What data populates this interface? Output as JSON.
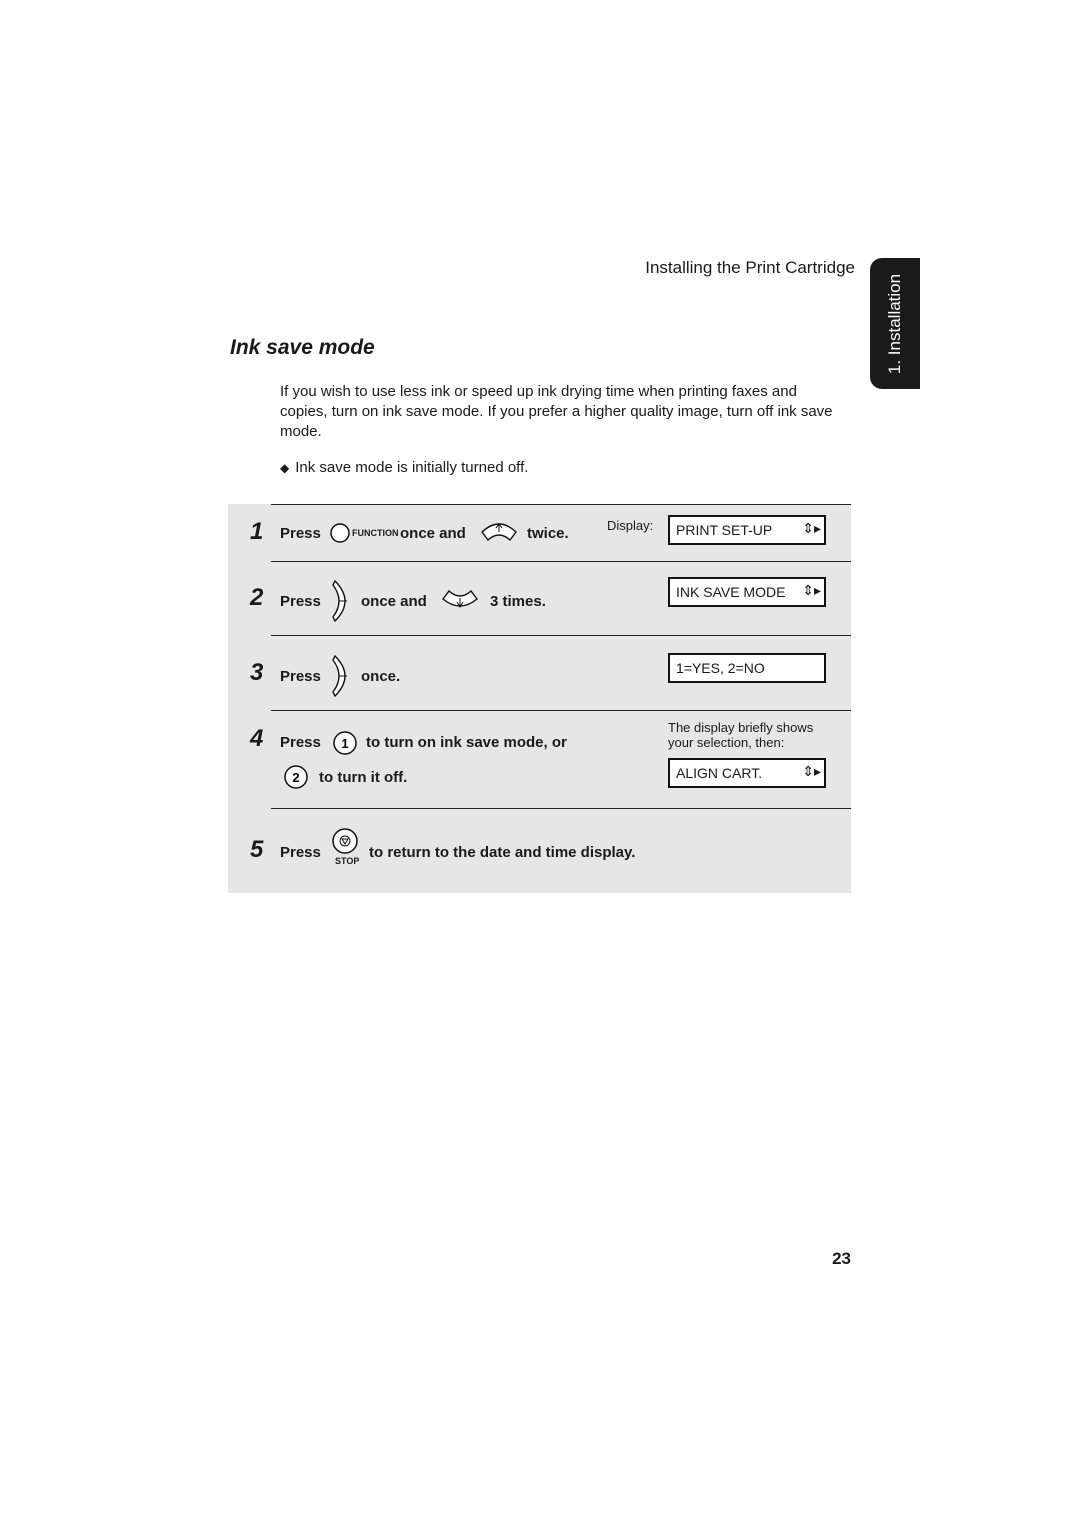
{
  "header": {
    "running_head": "Installing the Print Cartridge",
    "chapter_tab": "1. Installation"
  },
  "section": {
    "title": "Ink save mode",
    "intro": "If you wish to use less ink or speed up ink drying time when printing faxes and copies, turn on ink save mode. If you prefer a higher quality image, turn off ink save mode.",
    "bullet": "Ink save mode is initially turned off."
  },
  "steps": [
    {
      "number": "1",
      "press": "Press",
      "key_label": "FUNCTION",
      "mid": "once and",
      "end": "twice.",
      "display_label": "Display:",
      "display": "PRINT SET-UP"
    },
    {
      "number": "2",
      "press": "Press",
      "mid": "once and",
      "end": "3 times.",
      "display": "INK SAVE MODE"
    },
    {
      "number": "3",
      "press": "Press",
      "end": "once.",
      "display": "1=YES, 2=NO"
    },
    {
      "number": "4",
      "press": "Press",
      "key1": "1",
      "text1": "to turn on ink save mode, or",
      "key2": "2",
      "text2": "to turn it off.",
      "note": "The display briefly shows your selection, then:",
      "display": "ALIGN CART."
    },
    {
      "number": "5",
      "press": "Press",
      "key_label": "STOP",
      "end": "to return to the date and time display."
    }
  ],
  "footer": {
    "page_number": "23"
  }
}
